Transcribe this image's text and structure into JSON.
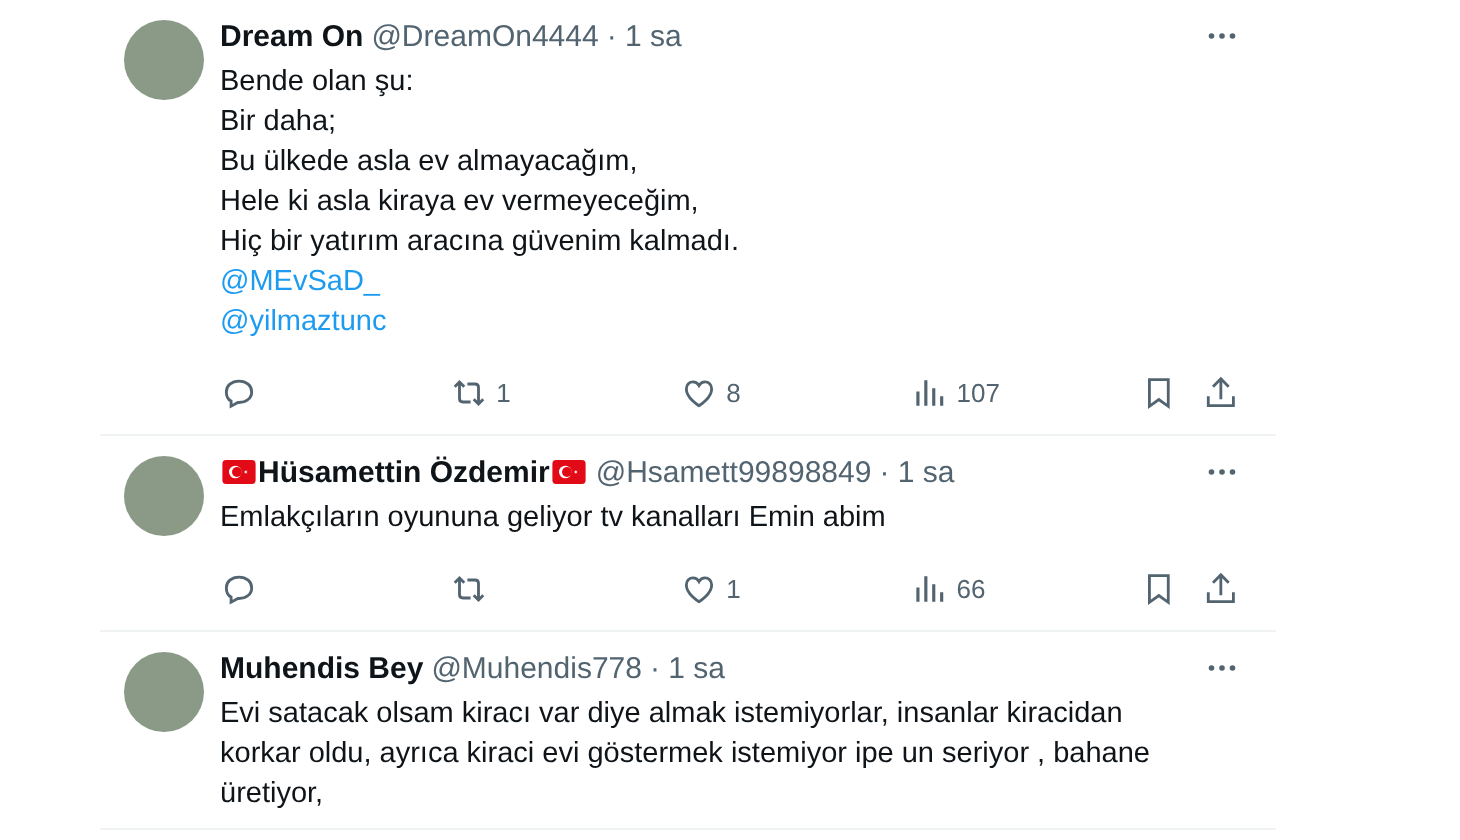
{
  "tweets": [
    {
      "name_parts": [
        {
          "kind": "text",
          "text": "Dream On"
        }
      ],
      "handle": "@DreamOn4444",
      "time": "· 1 sa",
      "lines": [
        {
          "kind": "text",
          "text": "Bende olan şu:"
        },
        {
          "kind": "text",
          "text": "Bir daha;"
        },
        {
          "kind": "text",
          "text": "Bu ülkede asla ev almayacağım,"
        },
        {
          "kind": "text",
          "text": "Hele ki asla kiraya ev vermeyeceğim,"
        },
        {
          "kind": "text",
          "text": "Hiç bir yatırım aracına güvenim kalmadı."
        },
        {
          "kind": "mention",
          "text": "@MEvSaD_"
        },
        {
          "kind": "mention",
          "text": "@yilmaztunc"
        }
      ],
      "stats": {
        "retweets": "1",
        "likes": "8",
        "views": "107"
      }
    },
    {
      "name_parts": [
        {
          "kind": "flag"
        },
        {
          "kind": "text",
          "text": "Hüsamettin Özdemir"
        },
        {
          "kind": "flag"
        }
      ],
      "handle": "@Hsamett99898849",
      "time": "· 1 sa",
      "lines": [
        {
          "kind": "text",
          "text": "Emlakçıların oyununa geliyor tv kanalları Emin abim"
        }
      ],
      "stats": {
        "likes": "1",
        "views": "66"
      }
    },
    {
      "name_parts": [
        {
          "kind": "text",
          "text": "Muhendis Bey"
        }
      ],
      "handle": "@Muhendis778",
      "time": "· 1 sa",
      "lines": [
        {
          "kind": "text",
          "text": "Evi satacak olsam kiracı var diye almak istemiyorlar, insanlar kiracidan korkar oldu, ayrıca kiraci evi göstermek istemiyor ipe un seriyor , bahane üretiyor,"
        }
      ]
    }
  ]
}
